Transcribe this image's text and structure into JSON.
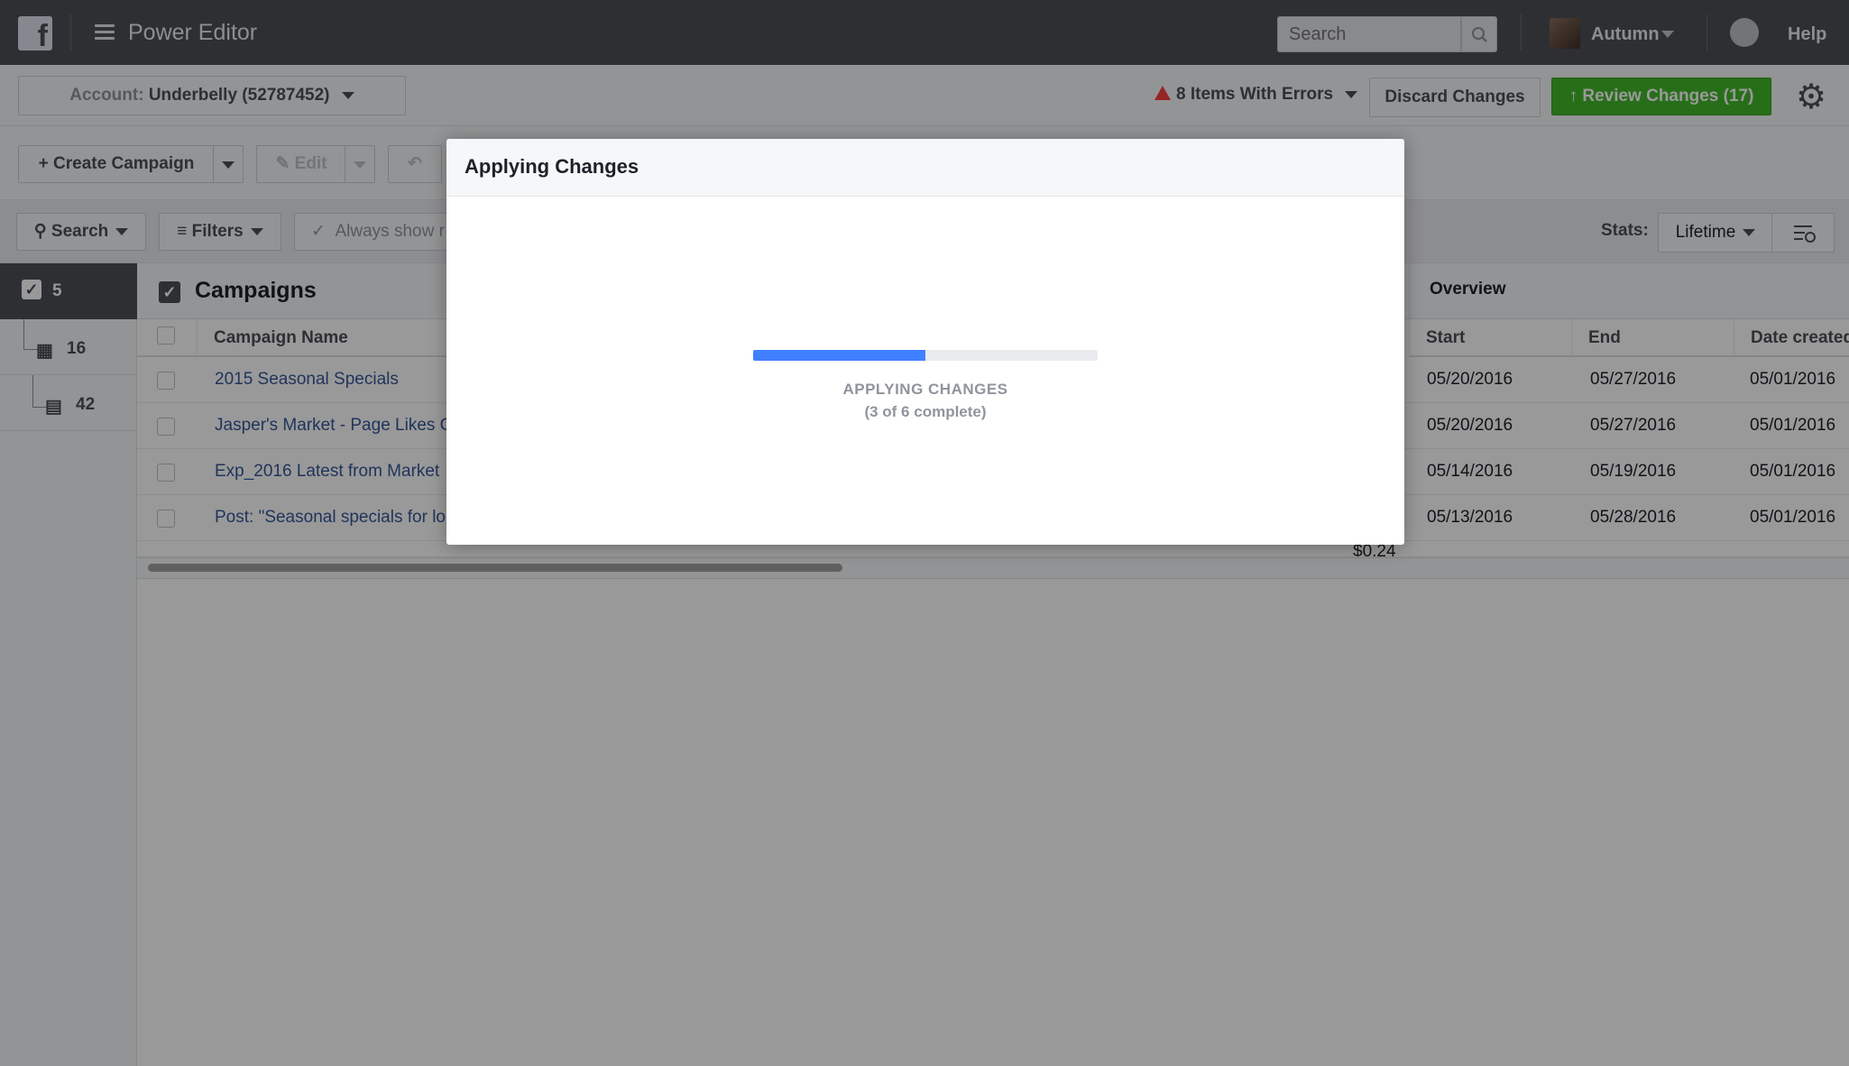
{
  "topbar": {
    "app_title": "Power Editor",
    "search_placeholder": "Search",
    "user_name": "Autumn",
    "help_label": "Help"
  },
  "account": {
    "prefix": "Account:",
    "name": "Underbelly (52787452)",
    "errors_label": "8 Items With Errors",
    "discard_label": "Discard Changes",
    "review_label": "Review Changes (17)"
  },
  "toolbar": {
    "create_label": "Create Campaign",
    "edit_label": "Edit"
  },
  "filterbar": {
    "search_label": "Search",
    "filters_label": "Filters",
    "always_show_label": "Always show r",
    "stats_label": "Stats:",
    "stats_value": "Lifetime"
  },
  "leftnav": {
    "campaigns_count": "5",
    "adsets_count": "16",
    "ads_count": "42"
  },
  "table": {
    "title": "Campaigns",
    "overview_label": "Overview",
    "columns": [
      "Campaign Name",
      "Start",
      "End",
      "Date created"
    ],
    "rows": [
      {
        "name": "2015 Seasonal Specials",
        "start": "05/20/2016",
        "end": "05/27/2016",
        "created": "05/01/2016"
      },
      {
        "name": "Jasper's Market - Page Likes C",
        "start": "05/20/2016",
        "end": "05/27/2016",
        "created": "05/01/2016"
      },
      {
        "name": "Exp_2016 Latest from Market",
        "start": "05/14/2016",
        "end": "05/19/2016",
        "created": "05/01/2016"
      },
      {
        "name": "Post: \"Seasonal specials for loc",
        "start": "05/13/2016",
        "end": "05/28/2016",
        "created": "05/01/2016"
      }
    ],
    "partial_amount": "$0.24"
  },
  "modal": {
    "title": "Applying Changes",
    "progress_label": "APPLYING CHANGES",
    "progress_sub": "(3 of 6 complete)",
    "progress_fraction": 0.5
  },
  "colors": {
    "topbar": "#4b4f56",
    "review_green": "#42b72a",
    "progress_blue": "#4080ff",
    "link_blue": "#365899",
    "warning_red": "#fa3e3e"
  }
}
